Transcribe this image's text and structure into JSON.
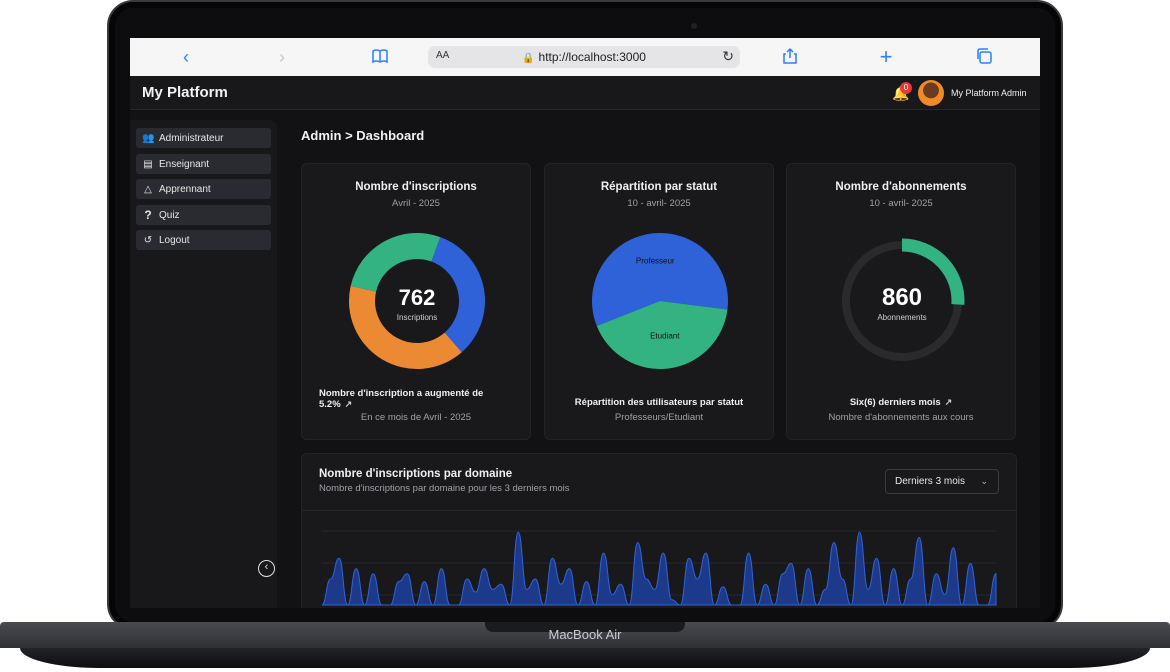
{
  "device": {
    "label": "MacBook Air"
  },
  "browser": {
    "url": "http://localhost:3000",
    "text_size_label": "AA",
    "icons": [
      "back-icon",
      "forward-icon",
      "bookmarks-icon",
      "reload-icon",
      "share-icon",
      "new-tab-icon",
      "tabs-icon"
    ]
  },
  "header": {
    "brand": "My Platform",
    "notification_count": "0",
    "user_name": "My Platform Admin"
  },
  "sidebar": {
    "items": [
      {
        "label": "Administrateur",
        "icon": "admin-icon"
      },
      {
        "label": "Enseignant",
        "icon": "teacher-icon"
      },
      {
        "label": "Apprennant",
        "icon": "learner-icon"
      },
      {
        "label": "Quiz",
        "icon": "question-icon"
      },
      {
        "label": "Logout",
        "icon": "logout-icon"
      }
    ]
  },
  "breadcrumb": {
    "root": "Admin",
    "separator": ">",
    "current": "Dashboard"
  },
  "cards": [
    {
      "title": "Nombre d'inscriptions",
      "subtitle": "Avril - 2025",
      "center_value": "762",
      "center_label": "Inscriptions",
      "foot_line1": "Nombre d'inscription a augmenté de 5.2%",
      "foot_line2": "En ce mois de Avril - 2025"
    },
    {
      "title": "Répartition par statut",
      "subtitle": "10 - avril- 2025",
      "foot_line1": "Répartition des utilisateurs par statut",
      "foot_line2": "Professeurs/Etudiant"
    },
    {
      "title": "Nombre d'abonnements",
      "subtitle": "10 - avril- 2025",
      "center_value": "860",
      "center_label": "Abonnements",
      "foot_line1": "Six(6) derniers mois",
      "foot_line2": "Nombre d'abonnements aux cours"
    }
  ],
  "domain_section": {
    "title": "Nombre d'inscriptions par domaine",
    "subtitle": "Nombre d'inscriptions par domaine pour les 3 derniers mois",
    "range_select": "Derniers 3 mois"
  },
  "colors": {
    "blue": "#2f62d8",
    "green": "#33b382",
    "orange": "#ec8a34",
    "ring_track": "#2a2a2d",
    "area_fill": "#1d3a8a"
  },
  "chart_data": [
    {
      "type": "pie",
      "variant": "donut",
      "series": [
        {
          "color": "#2f62d8",
          "value": 33
        },
        {
          "color": "#ec8a34",
          "value": 40
        },
        {
          "color": "#33b382",
          "value": 27
        }
      ]
    },
    {
      "type": "pie",
      "categories": [
        "Professeur",
        "Etudiant"
      ],
      "values": [
        58,
        42
      ]
    },
    {
      "type": "pie",
      "variant": "progress-ring",
      "values": [
        26
      ]
    },
    {
      "type": "area",
      "values": [
        0,
        10,
        18,
        0,
        14,
        0,
        12,
        0,
        0,
        9,
        12,
        0,
        9,
        0,
        14,
        0,
        0,
        10,
        5,
        14,
        6,
        8,
        0,
        28,
        6,
        10,
        0,
        18,
        8,
        14,
        0,
        9,
        0,
        20,
        4,
        8,
        0,
        24,
        10,
        6,
        20,
        2,
        0,
        18,
        10,
        20,
        0,
        7,
        0,
        0,
        20,
        0,
        8,
        0,
        12,
        16,
        0,
        14,
        0,
        6,
        24,
        10,
        0,
        28,
        6,
        18,
        0,
        14,
        0,
        10,
        26,
        0,
        12,
        4,
        22,
        0,
        16,
        0,
        0,
        12
      ],
      "grid": true
    }
  ]
}
